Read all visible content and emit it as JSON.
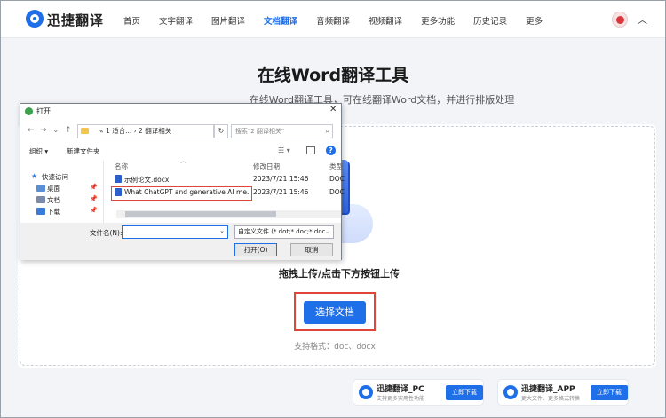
{
  "nav": {
    "brand": "迅捷翻译",
    "items": [
      "首页",
      "文字翻译",
      "图片翻译",
      "文档翻译",
      "音频翻译",
      "视频翻译",
      "更多功能",
      "历史记录",
      "更多"
    ],
    "active_index": 3
  },
  "hero": {
    "title": "在线Word翻译工具",
    "subtitle": "在线Word翻译工具，可在线翻译Word文档，并进行排版处理"
  },
  "upload": {
    "drag_text": "拖拽上传/点击下方按钮上传",
    "choose_button": "选择文档",
    "formats": "支持格式：doc、docx"
  },
  "promos": [
    {
      "name": "迅捷翻译_PC",
      "desc": "支持更多实用性功能",
      "download": "立即下载"
    },
    {
      "name": "迅捷翻译_APP",
      "desc": "更大文件、更多格式转换",
      "download": "立即下载"
    }
  ],
  "dialog": {
    "title": "打开",
    "path": "« 1 适合... › 2 翻译相关",
    "search_placeholder": "搜索\"2 翻译相关\"",
    "organize": "组织 ▾",
    "new_folder": "新建文件夹",
    "tree": [
      {
        "label": "快速访问",
        "icon": "star-icon"
      },
      {
        "label": "桌面",
        "icon": "desktop-icon"
      },
      {
        "label": "文档",
        "icon": "documents-icon"
      },
      {
        "label": "下载",
        "icon": "download-icon"
      }
    ],
    "columns": {
      "name": "名称",
      "date": "修改日期",
      "type": "类型"
    },
    "files": [
      {
        "name": "示例论文.docx",
        "date": "2023/7/21 15:46",
        "type": "DOC"
      },
      {
        "name": "What ChatGPT and generative AI me...",
        "date": "2023/7/21 15:46",
        "type": "DOC"
      }
    ],
    "filename_label": "文件名(N):",
    "filename_value": "",
    "filter": "自定义文件 (*.dot;*.doc;*.doc",
    "open_button": "打开(O)",
    "cancel_button": "取消"
  },
  "colors": {
    "accent": "#1e6fe8",
    "highlight": "#e0453a"
  }
}
